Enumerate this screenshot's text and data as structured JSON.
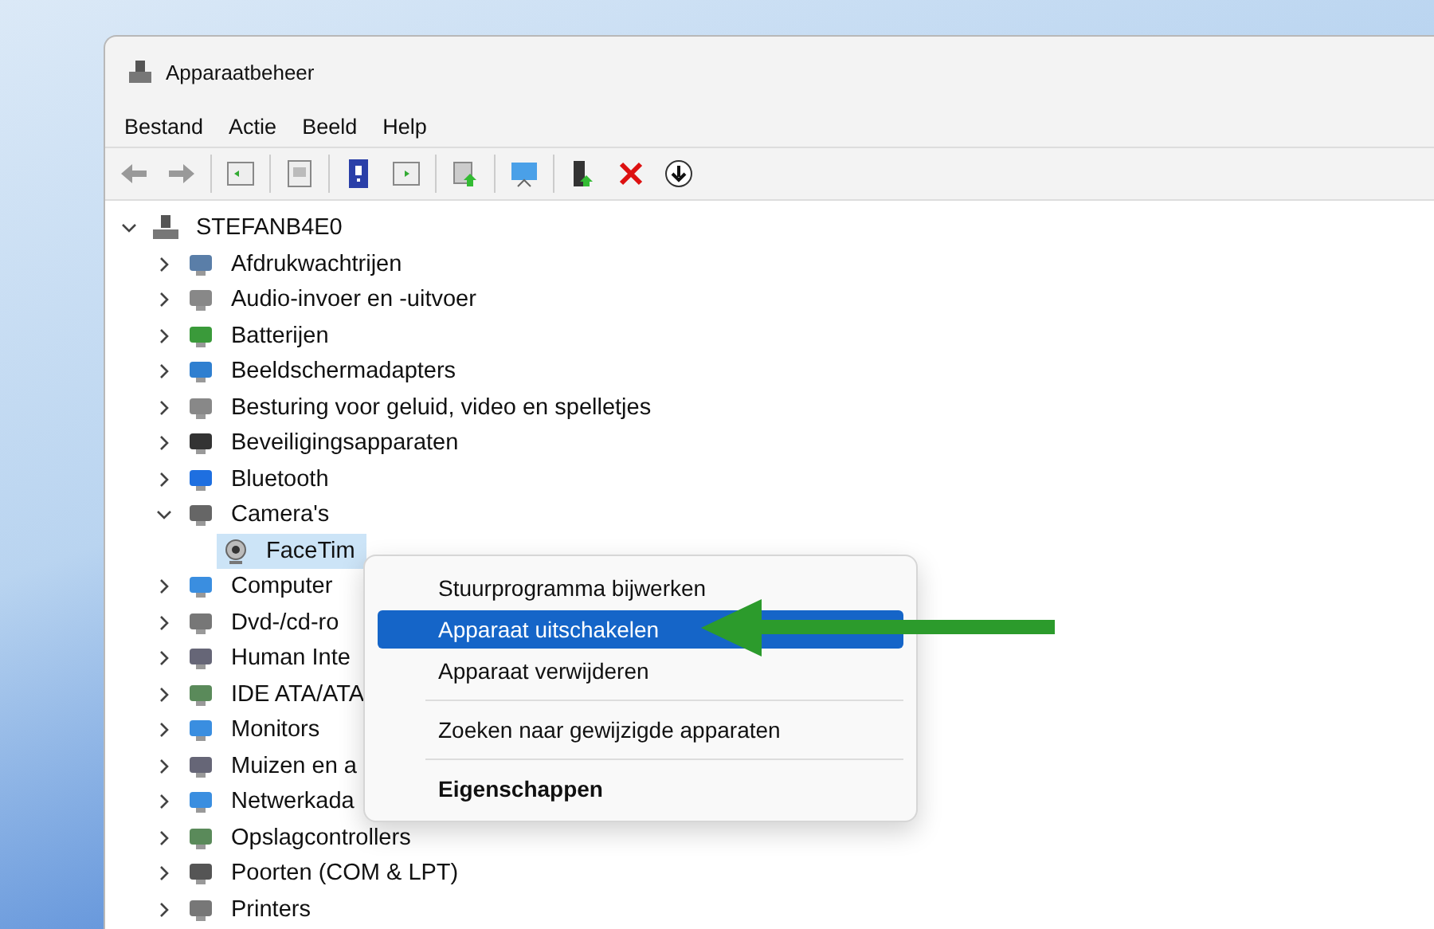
{
  "window": {
    "title": "Apparaatbeheer"
  },
  "menu_bar": [
    "Bestand",
    "Actie",
    "Beeld",
    "Help"
  ],
  "tree": {
    "label": "STEFANB4E0",
    "expanded": true,
    "selected": false,
    "children": [
      {
        "label": "Afdrukwachtrijen",
        "expanded": false,
        "selected": false
      },
      {
        "label": "Audio-invoer en -uitvoer",
        "expanded": false,
        "selected": false
      },
      {
        "label": "Batterijen",
        "expanded": false,
        "selected": false
      },
      {
        "label": "Beeldschermadapters",
        "expanded": false,
        "selected": false
      },
      {
        "label": "Besturing voor geluid, video en spelletjes",
        "expanded": false,
        "selected": false
      },
      {
        "label": "Beveiligingsapparaten",
        "expanded": false,
        "selected": false
      },
      {
        "label": "Bluetooth",
        "expanded": false,
        "selected": false
      },
      {
        "label": "Camera's",
        "expanded": true,
        "selected": false,
        "children": [
          {
            "label": "FaceTim",
            "selected": true
          }
        ]
      },
      {
        "label": "Computer",
        "expanded": false,
        "selected": false
      },
      {
        "label": "Dvd-/cd-ro",
        "expanded": false,
        "selected": false
      },
      {
        "label": "Human Inte",
        "expanded": false,
        "selected": false
      },
      {
        "label": "IDE ATA/ATA",
        "expanded": false,
        "selected": false
      },
      {
        "label": "Monitors",
        "expanded": false,
        "selected": false
      },
      {
        "label": "Muizen en a",
        "expanded": false,
        "selected": false
      },
      {
        "label": "Netwerkada",
        "expanded": false,
        "selected": false
      },
      {
        "label": "Opslagcontrollers",
        "expanded": false,
        "selected": false
      },
      {
        "label": "Poorten (COM & LPT)",
        "expanded": false,
        "selected": false
      },
      {
        "label": "Printers",
        "expanded": false,
        "selected": false
      }
    ]
  },
  "context_menu": [
    {
      "label": "Stuurprogramma bijwerken",
      "kind": "item",
      "selected": false
    },
    {
      "label": "Apparaat uitschakelen",
      "kind": "item",
      "selected": true
    },
    {
      "label": "Apparaat verwijderen",
      "kind": "item",
      "selected": false
    },
    {
      "kind": "separator"
    },
    {
      "label": "Zoeken naar gewijzigde apparaten",
      "kind": "item",
      "selected": false
    },
    {
      "kind": "separator"
    },
    {
      "label": "Eigenschappen",
      "kind": "default",
      "selected": false
    }
  ]
}
